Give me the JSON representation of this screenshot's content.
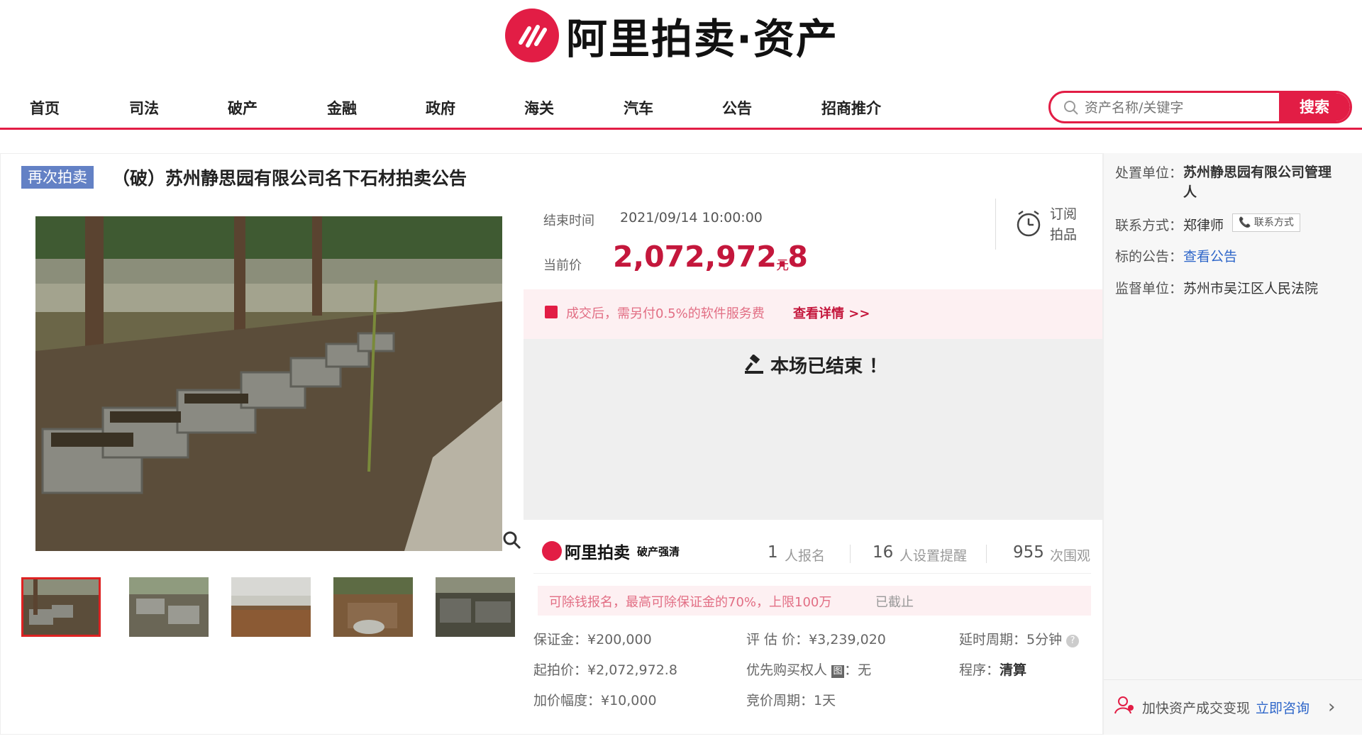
{
  "brand": {
    "logo_text": "阿里拍卖·资产",
    "small_logo_text": "阿里拍卖",
    "small_logo_sub": "破产强清"
  },
  "nav": {
    "items": [
      "首页",
      "司法",
      "破产",
      "金融",
      "政府",
      "海关",
      "汽车",
      "公告",
      "招商推介"
    ]
  },
  "search": {
    "placeholder": "资产名称/关键字",
    "button_label": "搜索"
  },
  "listing": {
    "badge": "再次拍卖",
    "title": "（破）苏州静思园有限公司名下石材拍卖公告",
    "end_time_label": "结束时间",
    "end_time": "2021/09/14 10:00:00",
    "price_label": "当前价",
    "price": "2,072,972.8",
    "price_unit": "元",
    "subscribe_label_1": "订阅",
    "subscribe_label_2": "拍品",
    "notice_text": "成交后，需另付0.5%的软件服务费",
    "notice_link": "查看详情 >>",
    "ended_text": "本场已结束 ！"
  },
  "stats": [
    {
      "num": "1",
      "label": "人报名"
    },
    {
      "num": "16",
      "label": "人设置提醒"
    },
    {
      "num": "955",
      "label": "次围观"
    }
  ],
  "deposit": {
    "text": "可除钱报名，最高可除保证金的70%，上限100万",
    "status": "已截止"
  },
  "details": {
    "deposit": "保证金：¥200,000",
    "start_price": "起拍价：¥2,072,972.8",
    "increment": "加价幅度：¥10,000",
    "appraisal": "评 估 价：¥3,239,020",
    "priority_label": "优先购买权人",
    "priority_tag": "图",
    "priority_value": "：无",
    "cycle": "竞价周期：1天",
    "delay_label": "延时周期：",
    "delay_value": "5分钟",
    "procedure_label": "程序：",
    "procedure_value": "清算"
  },
  "side": {
    "disposal_label": "处置单位：",
    "disposal_value": "苏州静思园有限公司管理人",
    "contact_label": "联系方式：",
    "contact_value": "郑律师",
    "contact_button": "📞 联系方式",
    "announcement_label": "标的公告：",
    "announcement_link": "查看公告",
    "supervisor_label": "监督单位：",
    "supervisor_value": "苏州市吴江区人民法院",
    "consult_text": "加快资产成交变现",
    "consult_link": "立即咨询"
  },
  "colors": {
    "accent": "#e21d45",
    "price": "#c4173c",
    "badge": "#6381c5",
    "link": "#2e66c9"
  }
}
